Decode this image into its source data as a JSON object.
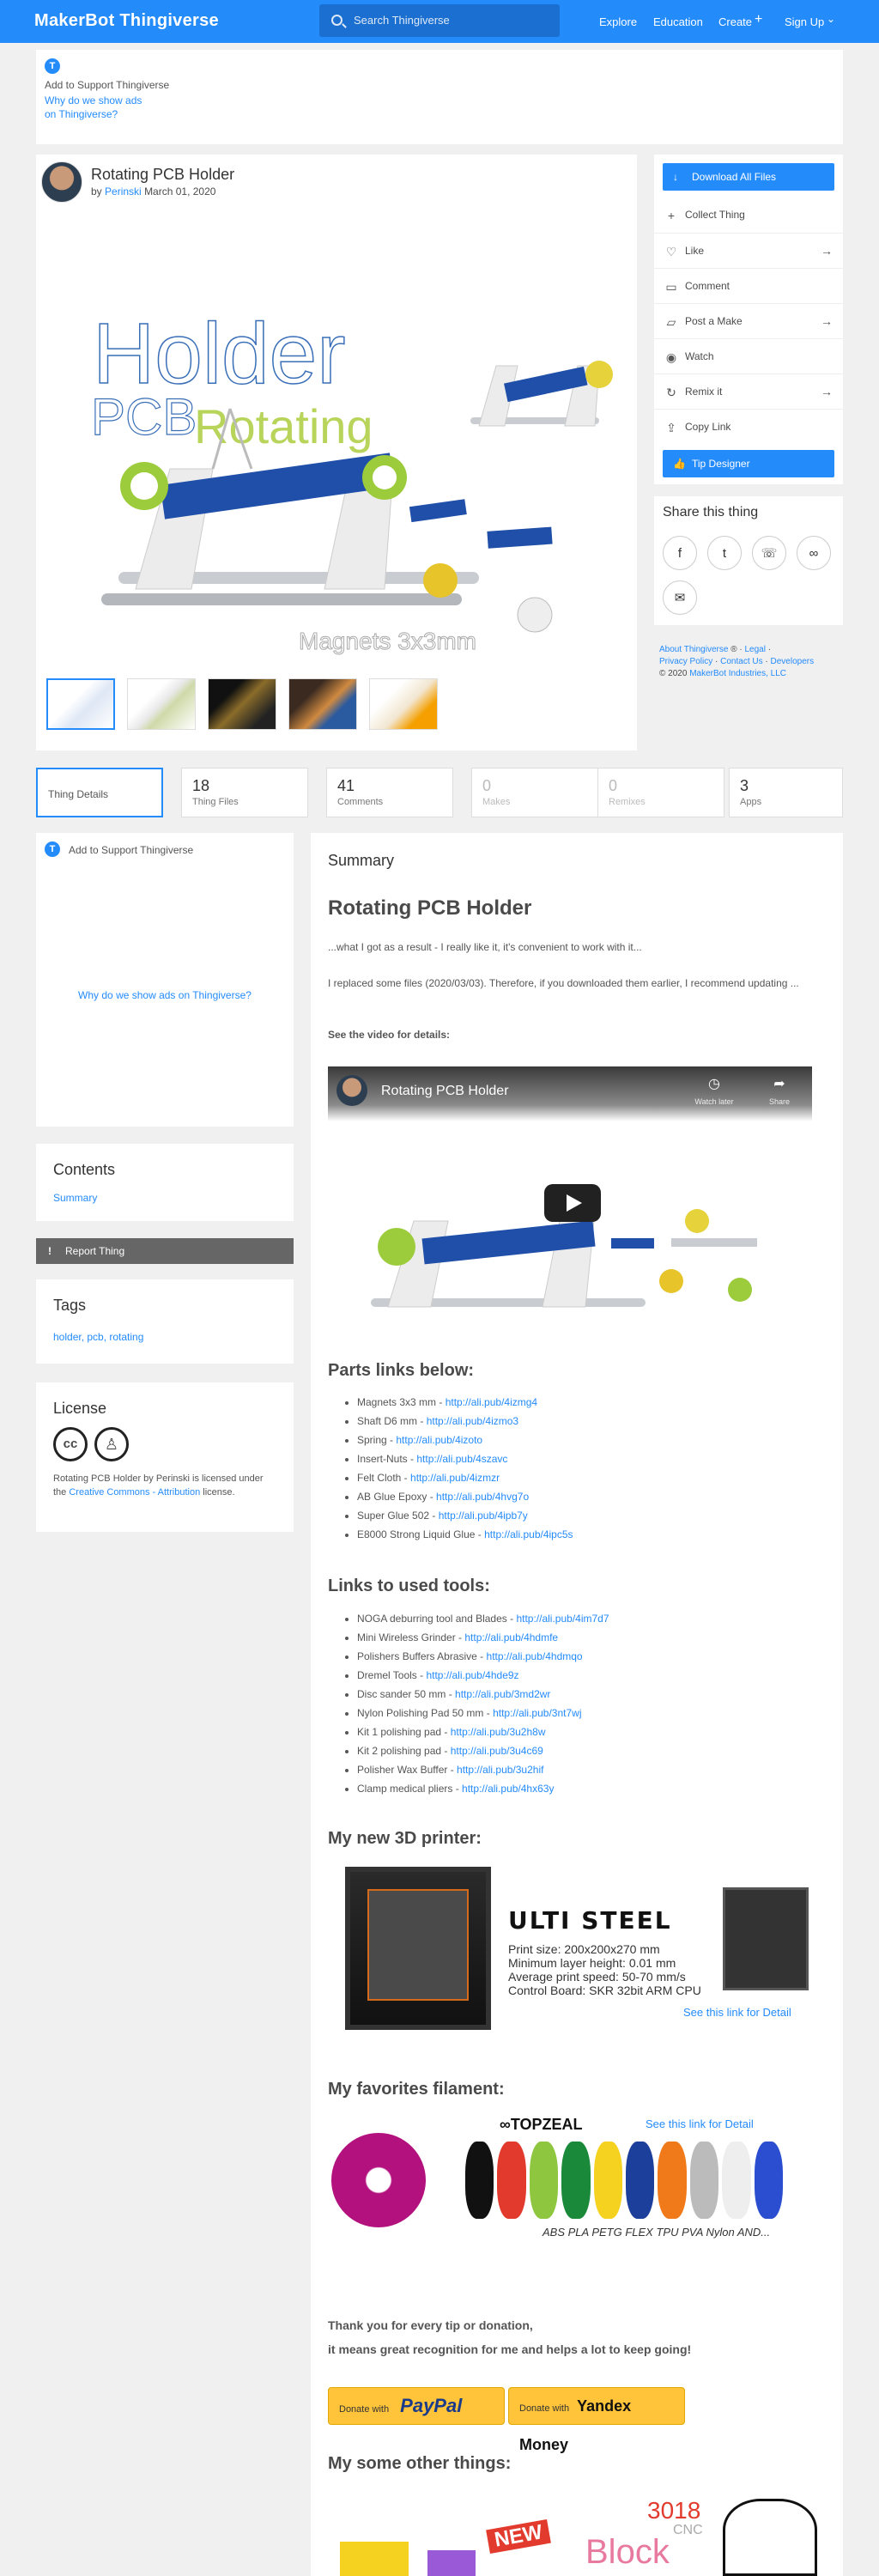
{
  "header": {
    "logo_a": "MakerBot",
    "logo_b": "Thingiverse",
    "search_placeholder": "Search Thingiverse",
    "nav": [
      "Explore",
      "Education",
      "Create",
      "Sign Up"
    ]
  },
  "ad_top": {
    "badge": "T",
    "support": "Add to Support Thingiverse",
    "why_1": "Why do we show ads",
    "why_2": "on Thingiverse?"
  },
  "thing": {
    "title": "Rotating PCB Holder",
    "by": "by",
    "author": "Perinski",
    "date": "March 01, 2020"
  },
  "hero": {
    "word_holder": "Holder",
    "word_pcb": "PCB",
    "word_rotating": "Rotating",
    "caption": "Magnets 3x3mm"
  },
  "actions": {
    "download": "Download All Files",
    "collect": "Collect Thing",
    "like": "Like",
    "comment": "Comment",
    "post_make": "Post a Make",
    "watch": "Watch",
    "remix": "Remix it",
    "copy_link": "Copy Link",
    "tip": "Tip Designer"
  },
  "share": {
    "title": "Share this thing"
  },
  "footer_links": {
    "about": "About Thingiverse",
    "reg": "®",
    "legal": "Legal",
    "privacy": "Privacy Policy",
    "contact": "Contact Us",
    "developers": "Developers",
    "copyright": "© 2020",
    "company": "MakerBot Industries, LLC"
  },
  "stats": [
    {
      "n": "",
      "l": "Thing Details"
    },
    {
      "n": "18",
      "l": "Thing Files"
    },
    {
      "n": "41",
      "l": "Comments"
    },
    {
      "n": "0",
      "l": "Makes"
    },
    {
      "n": "0",
      "l": "Remixes"
    },
    {
      "n": "3",
      "l": "Apps"
    }
  ],
  "ad_side": {
    "support": "Add to Support Thingiverse",
    "why": "Why do we show ads on Thingiverse?"
  },
  "contents": {
    "title": "Contents",
    "item": "Summary"
  },
  "report": "Report Thing",
  "tags": {
    "title": "Tags",
    "list": "holder, pcb, rotating"
  },
  "license": {
    "title": "License",
    "text_1": "Rotating PCB Holder by Perinski is licensed under the",
    "link": "Creative Commons - Attribution",
    "text_2": "license."
  },
  "summary": {
    "label": "Summary",
    "title": "Rotating PCB Holder",
    "p1": "...what I got as a result - I really like it, it's convenient to work with it...",
    "p2": "I replaced some files (2020/03/03). Therefore, if you downloaded them earlier, I recommend updating ...",
    "p3": "See the video for details:",
    "video_title": "Rotating PCB Holder",
    "video_watch": "Watch later",
    "video_share": "Share",
    "parts_title": "Parts links below:",
    "parts": [
      {
        "name": "Magnets 3x3 mm - ",
        "url": "http://ali.pub/4izmg4"
      },
      {
        "name": "Shaft D6 mm - ",
        "url": "http://ali.pub/4izmo3"
      },
      {
        "name": "Spring - ",
        "url": "http://ali.pub/4izoto"
      },
      {
        "name": "Insert-Nuts - ",
        "url": "http://ali.pub/4szavc"
      },
      {
        "name": "Felt Cloth - ",
        "url": "http://ali.pub/4izmzr"
      },
      {
        "name": "AB Glue Epoxy - ",
        "url": "http://ali.pub/4hvg7o"
      },
      {
        "name": "Super Glue 502 - ",
        "url": "http://ali.pub/4ipb7y"
      },
      {
        "name": "E8000 Strong Liquid Glue - ",
        "url": "http://ali.pub/4ipc5s"
      }
    ],
    "tools_title": "Links to used tools:",
    "tools": [
      {
        "name": "NOGA deburring tool and Blades - ",
        "url": "http://ali.pub/4im7d7"
      },
      {
        "name": "Mini Wireless Grinder - ",
        "url": "http://ali.pub/4hdmfe"
      },
      {
        "name": "Polishers Buffers Abrasive - ",
        "url": "http://ali.pub/4hdmqo"
      },
      {
        "name": "Dremel Tools - ",
        "url": "http://ali.pub/4hde9z"
      },
      {
        "name": "Disc sander 50 mm - ",
        "url": "http://ali.pub/3md2wr"
      },
      {
        "name": "Nylon Polishing Pad 50 mm - ",
        "url": "http://ali.pub/3nt7wj"
      },
      {
        "name": "Kit 1 polishing pad - ",
        "url": "http://ali.pub/3u2h8w"
      },
      {
        "name": "Kit 2 polishing pad - ",
        "url": "http://ali.pub/3u4c69"
      },
      {
        "name": "Polisher Wax Buffer - ",
        "url": "http://ali.pub/3u2hif"
      },
      {
        "name": "Clamp medical pliers - ",
        "url": "http://ali.pub/4hx63y"
      }
    ],
    "printer_title": "My new 3D printer:",
    "printer_name": "ULTI STEEL",
    "printer_specs": [
      "Print size: 200x200x270 mm",
      "Minimum layer height: 0.01 mm",
      "Average print speed: 50-70 mm/s",
      "Control Board: SKR 32bit ARM CPU"
    ],
    "printer_link": "See this link for Detail",
    "filament_title": "My favorites filament:",
    "filament_brand": "TOPZEAL",
    "filament_link": "See this link for Detail",
    "filament_types": "ABS PLA PETG FLEX TPU PVA Nylon AND...",
    "thanks_1": "Thank you for every tip or donation,",
    "thanks_2": "it means great recognition for me and helps a lot to keep going!",
    "donate_with": "Donate with",
    "paypal": "PayPal",
    "yandex": "Yandex Money",
    "other_title": "My some other things:",
    "other_new": "NEW",
    "other_3018": "3018",
    "other_block": "Block",
    "other_cnc": "CNC"
  },
  "colors": {
    "accent": "#248bfb",
    "report_bg": "#666666",
    "donate": "#ffc43a"
  }
}
